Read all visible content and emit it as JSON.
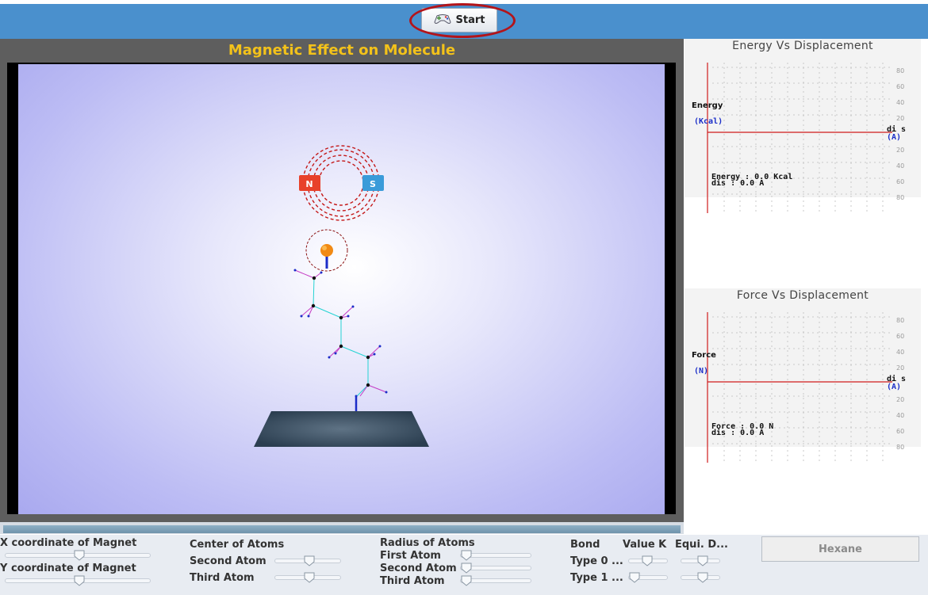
{
  "toolbar": {
    "start_label": "Start",
    "start_icon": "gamepad-icon"
  },
  "simulation": {
    "title": "Magnetic Effect on Molecule",
    "magnet": {
      "north_label": "N",
      "south_label": "S",
      "north_color": "#e8412a",
      "south_color": "#3a9bd9"
    },
    "progress": 1.0
  },
  "energy_graph": {
    "title": "Energy Vs Displacement",
    "y_name": "Energy",
    "y_unit": "(Kcal)",
    "x_name": "di s",
    "x_unit": "(A)",
    "ticks": [
      "80",
      "60",
      "40",
      "20",
      "20",
      "40",
      "60",
      "80"
    ],
    "readout_value": "Energy : 0.0 Kcal",
    "readout_dis": "dis : 0.0 A"
  },
  "force_graph": {
    "title": "Force Vs Displacement",
    "y_name": "Force",
    "y_unit": "(N)",
    "x_name": "di s",
    "x_unit": "(A)",
    "ticks": [
      "80",
      "60",
      "40",
      "20",
      "20",
      "40",
      "60",
      "80"
    ],
    "readout_value": "Force : 0.0 N",
    "readout_dis": "dis : 0.0 A"
  },
  "controls": {
    "x_magnet": "X coordinate of Magnet",
    "y_magnet": "Y coordinate of Magnet",
    "center_atoms": "Center of Atoms",
    "second_atom": "Second Atom",
    "third_atom": "Third Atom",
    "radius_atoms": "Radius of Atoms",
    "radius_first": "First Atom",
    "radius_second": "Second Atom",
    "radius_third": "Third Atom",
    "bond": "Bond",
    "value_k": "Value K",
    "equi_d": "Equi. D...",
    "type0": "Type 0 ...",
    "type1": "Type 1 ...",
    "molecule_button": "Hexane"
  },
  "colors": {
    "accent": "#4a90cd",
    "title_yellow": "#f3c21a",
    "axis_red": "#d01c1c"
  }
}
